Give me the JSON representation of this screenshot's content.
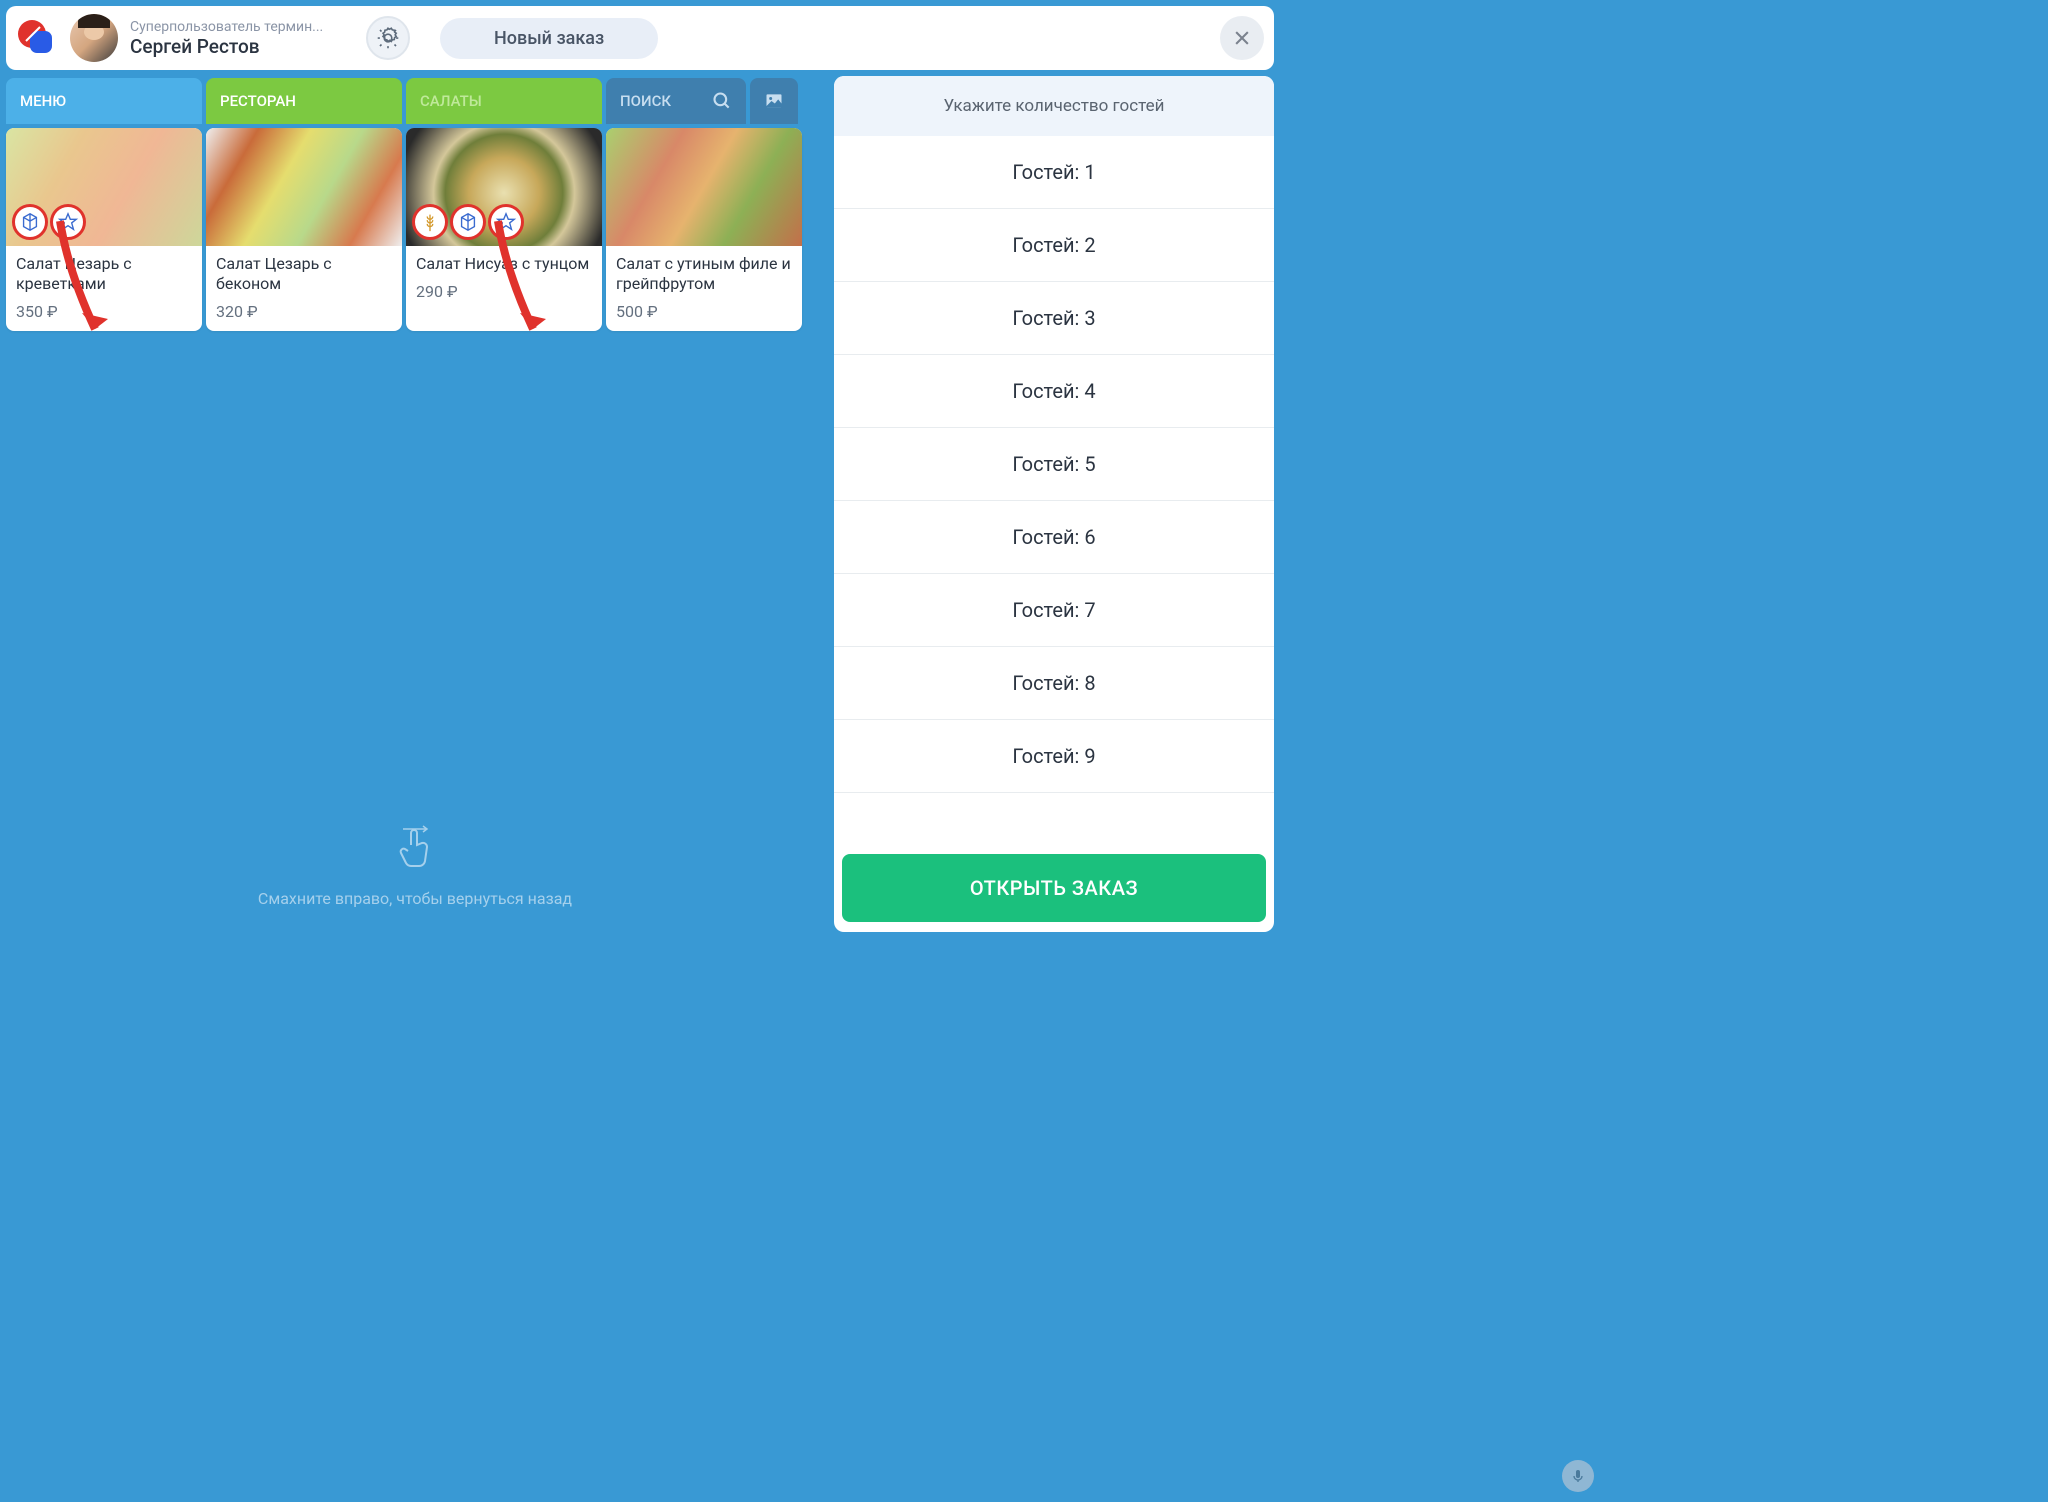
{
  "header": {
    "user_role": "Суперпользователь термин...",
    "user_name": "Сергей Рестов",
    "new_order_label": "Новый заказ"
  },
  "tabs": {
    "menu": "МЕНЮ",
    "restaurant": "РЕСТОРАН",
    "salads": "САЛАТЫ",
    "search": "ПОИСК"
  },
  "items": [
    {
      "title": "Салат Цезарь с креветками",
      "price": "350 ₽",
      "badges": [
        "cube-icon",
        "star-icon"
      ]
    },
    {
      "title": "Салат Цезарь с беконом",
      "price": "320 ₽",
      "badges": []
    },
    {
      "title": "Салат Нисуаз с тунцом",
      "price": "290 ₽",
      "badges": [
        "wheat-icon",
        "cube-icon",
        "star-icon"
      ]
    },
    {
      "title": "Салат с утиным филе и грейпфрутом",
      "price": "500 ₽",
      "badges": []
    }
  ],
  "swipe_hint": "Смахните вправо, чтобы вернуться назад",
  "guests": {
    "header": "Укажите количество гостей",
    "options": [
      "Гостей: 1",
      "Гостей: 2",
      "Гостей: 3",
      "Гостей: 4",
      "Гостей: 5",
      "Гостей: 6",
      "Гостей: 7",
      "Гостей: 8",
      "Гостей: 9"
    ],
    "open_button": "ОТКРЫТЬ ЗАКАЗ"
  },
  "colors": {
    "brand_red": "#e0322c",
    "brand_blue": "#295be6",
    "accent_green": "#1bc07d"
  }
}
